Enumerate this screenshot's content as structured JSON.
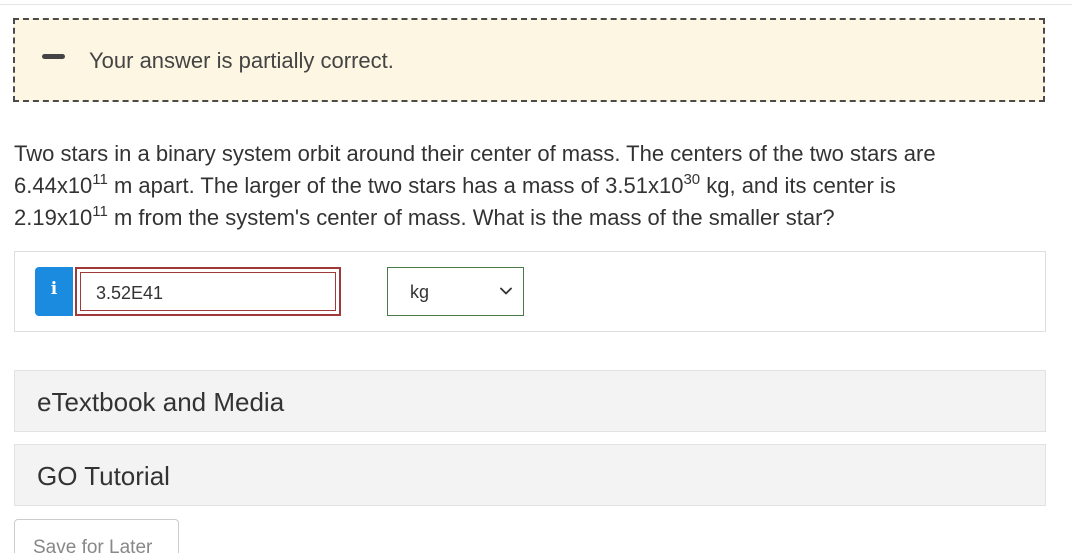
{
  "feedback": {
    "message": "Your answer is partially correct.",
    "icon": "minus-icon"
  },
  "question": {
    "line1": "Two stars in a binary system orbit around their center of mass. The centers of the two stars are",
    "sep_mantissa": "6.44x10",
    "sep_exp": "11",
    "seg_after_sep": " m apart. The larger of the two stars has a mass of ",
    "mass_mantissa": "3.51x10",
    "mass_exp": "30",
    "seg_after_mass": " kg, and its center is",
    "dist_mantissa": "2.19x10",
    "dist_exp": "11",
    "seg_after_dist": " m from the system's center of mass. What is the mass of the smaller star?"
  },
  "answer": {
    "info_glyph": "i",
    "value": "3.52E41",
    "unit_selected": "kg"
  },
  "panels": {
    "etextbook_label": "eTextbook and Media",
    "go_tutorial_label": "GO Tutorial"
  },
  "actions": {
    "save_label": "Save for Later"
  },
  "colors": {
    "banner_bg": "#fdf6e3",
    "info_blue": "#1b8be0",
    "input_border_error": "#a03a3a",
    "select_border": "#4a7a4a"
  }
}
